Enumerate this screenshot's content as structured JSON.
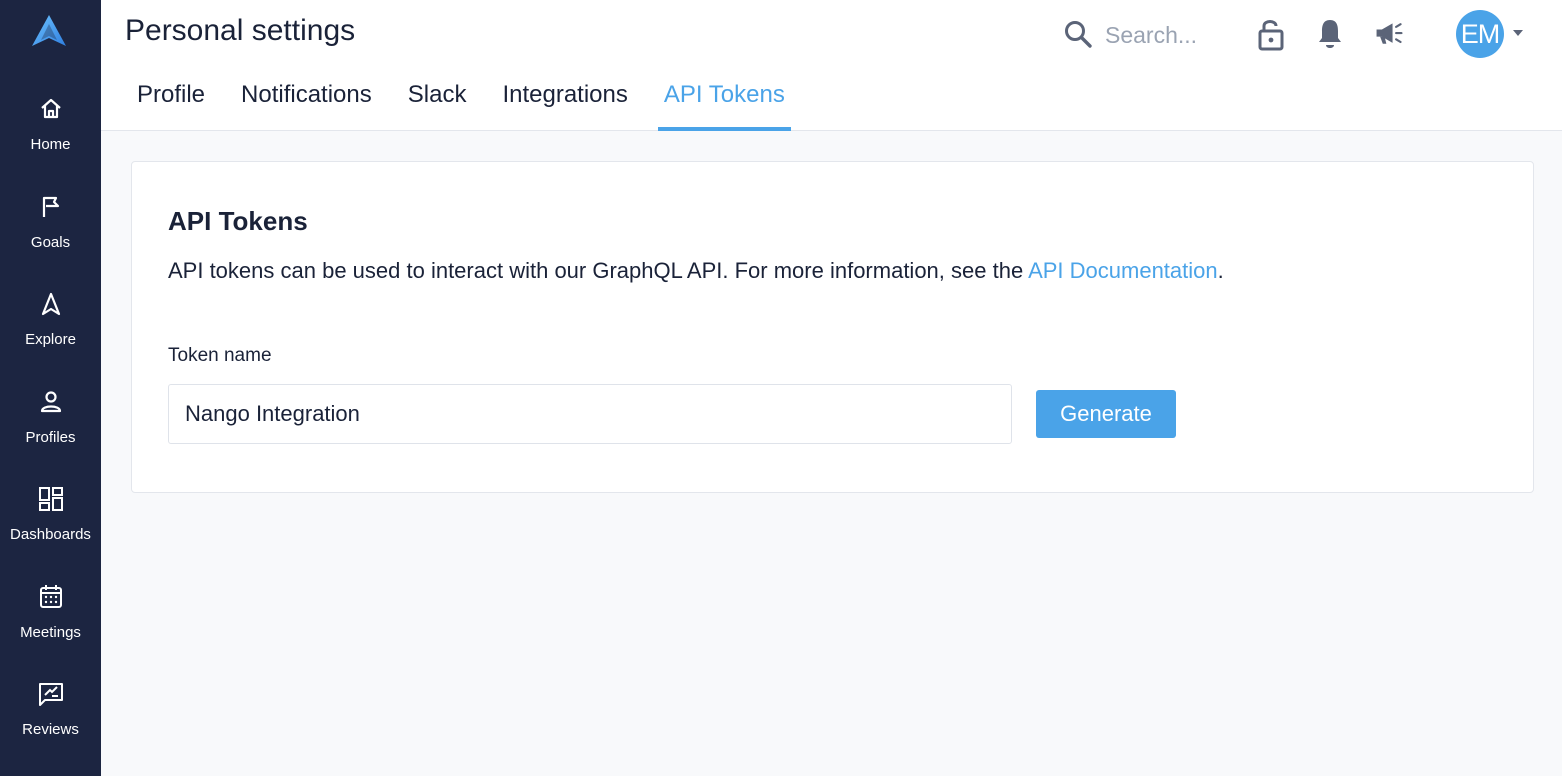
{
  "sidebar": {
    "logo": "brand-logo",
    "items": [
      {
        "label": "Home",
        "icon": "home-icon"
      },
      {
        "label": "Goals",
        "icon": "flag-icon"
      },
      {
        "label": "Explore",
        "icon": "navigation-arrow-icon"
      },
      {
        "label": "Profiles",
        "icon": "person-icon"
      },
      {
        "label": "Dashboards",
        "icon": "dashboard-grid-icon"
      },
      {
        "label": "Meetings",
        "icon": "calendar-icon"
      },
      {
        "label": "Reviews",
        "icon": "review-icon"
      }
    ]
  },
  "header": {
    "title": "Personal settings",
    "tabs": [
      {
        "label": "Profile",
        "active": false
      },
      {
        "label": "Notifications",
        "active": false
      },
      {
        "label": "Slack",
        "active": false
      },
      {
        "label": "Integrations",
        "active": false
      },
      {
        "label": "API Tokens",
        "active": true
      }
    ],
    "search": {
      "placeholder": "Search..."
    },
    "icons": [
      "search-icon",
      "lock-icon",
      "bell-icon",
      "megaphone-icon"
    ],
    "avatar_initials": "EM"
  },
  "main": {
    "title": "API Tokens",
    "description_prefix": "API tokens can be used to interact with our GraphQL API. For more information, see the ",
    "description_link": "API Documentation",
    "description_suffix": ".",
    "field_label": "Token name",
    "token_name_value": "Nango Integration",
    "generate_label": "Generate"
  },
  "colors": {
    "sidebar_bg": "#1c2541",
    "accent": "#4aa3e8",
    "text": "#1a2238",
    "page_bg": "#f8f9fb"
  }
}
